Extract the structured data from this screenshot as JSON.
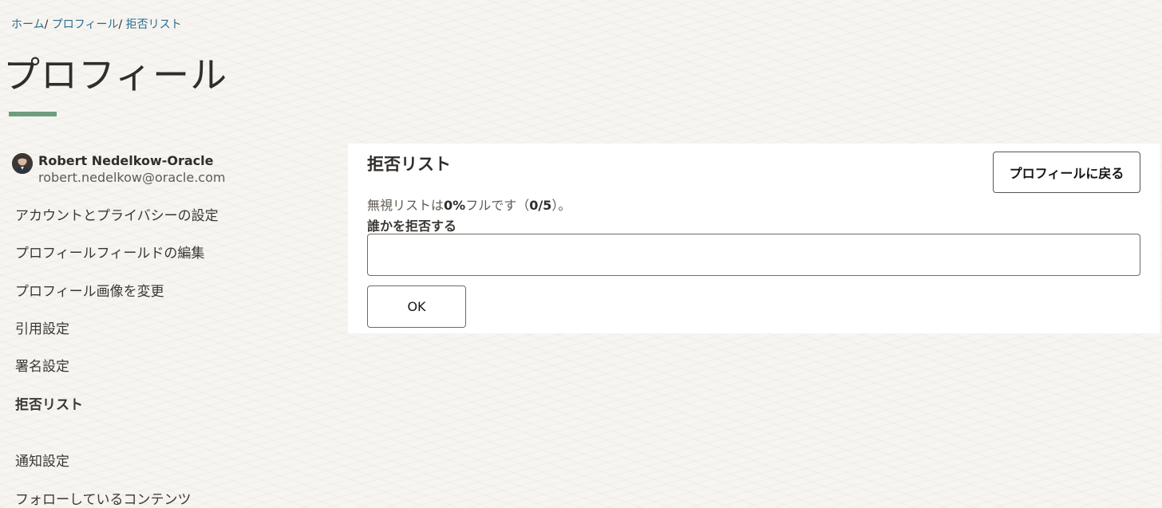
{
  "breadcrumb": {
    "items": [
      "ホーム",
      "プロフィール",
      "拒否リスト"
    ],
    "separator": "/"
  },
  "page": {
    "title": "プロフィール"
  },
  "user": {
    "name": "Robert Nedelkow-Oracle",
    "email": "robert.nedelkow@oracle.com"
  },
  "sidebar": {
    "items": [
      {
        "label": "アカウントとプライバシーの設定",
        "active": false
      },
      {
        "label": "プロフィールフィールドの編集",
        "active": false
      },
      {
        "label": "プロフィール画像を変更",
        "active": false
      },
      {
        "label": "引用設定",
        "active": false
      },
      {
        "label": "署名設定",
        "active": false
      },
      {
        "label": "拒否リスト",
        "active": true
      },
      {
        "label": "通知設定",
        "active": false
      },
      {
        "label": "フォローしているコンテンツ",
        "active": false
      }
    ]
  },
  "main": {
    "title": "拒否リスト",
    "back_button_label": "プロフィールに戻る",
    "status": {
      "prefix": "無視リストは",
      "percent": "0%",
      "middle": "フルです（",
      "count": "0/5",
      "suffix": "）。"
    },
    "field_label": "誰かを拒否する",
    "input_value": "",
    "ok_label": "OK"
  },
  "colors": {
    "accent_underline": "#6e9e7f",
    "link": "#2a6c91",
    "background": "#f7f5f1"
  }
}
